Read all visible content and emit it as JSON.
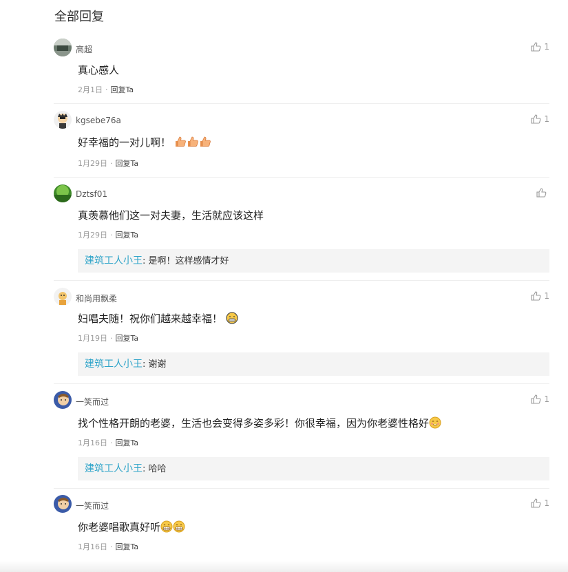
{
  "section_title": "全部回复",
  "comments": [
    {
      "username": "高超",
      "content": "真心感人",
      "date": "2月1日",
      "reply_label": "回复Ta",
      "likes": "1"
    },
    {
      "username": "kgsebe76a",
      "content": "好幸福的一对儿啊！",
      "emoji": [
        "thumbs-up",
        "thumbs-up",
        "thumbs-up"
      ],
      "date": "1月29日",
      "reply_label": "回复Ta",
      "likes": "1"
    },
    {
      "username": "Dztsf01",
      "content": "真羡慕他们这一对夫妻，生活就应该这样",
      "date": "1月29日",
      "reply_label": "回复Ta",
      "likes": "",
      "sub_reply": {
        "author": "建筑工人小王",
        "text": ": 是啊！这样感情才好"
      }
    },
    {
      "username": "和尚用飘柔",
      "content": "妇唱夫随！祝你们越来越幸福！",
      "emoji": [
        "grin"
      ],
      "date": "1月19日",
      "reply_label": "回复Ta",
      "likes": "1",
      "sub_reply": {
        "author": "建筑工人小王",
        "text": ": 谢谢"
      }
    },
    {
      "username": "一笑而过",
      "content": "找个性格开朗的老婆，生活也会变得多姿多彩！你很幸福，因为你老婆性格好",
      "emoji": [
        "smile"
      ],
      "date": "1月16日",
      "reply_label": "回复Ta",
      "likes": "1",
      "sub_reply": {
        "author": "建筑工人小王",
        "text": ": 哈哈"
      }
    },
    {
      "username": "一笑而过",
      "content": "你老婆唱歌真好听",
      "emoji": [
        "grin",
        "grin"
      ],
      "date": "1月16日",
      "reply_label": "回复Ta",
      "likes": "1"
    }
  ],
  "colors": {
    "reply_author": "#2ea4c9",
    "meta_text": "#999999",
    "sub_reply_bg": "#f4f4f4"
  },
  "icons": {
    "like": "thumbs-up-outline-icon"
  }
}
